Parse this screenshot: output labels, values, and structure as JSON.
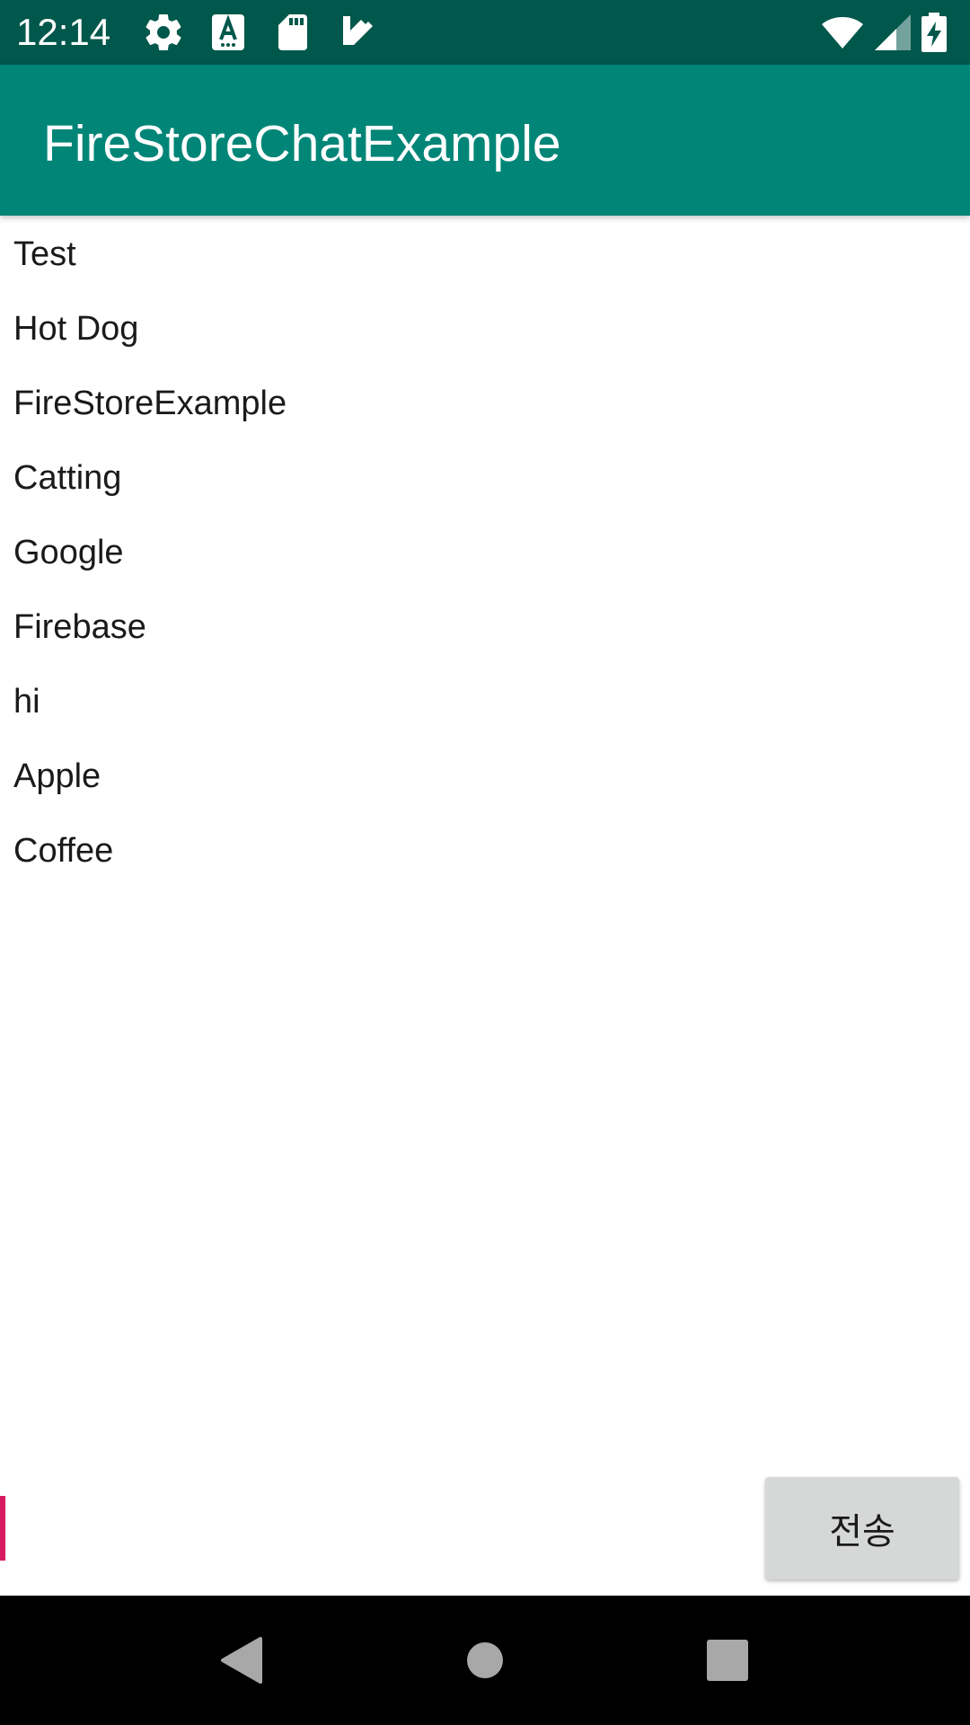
{
  "status_bar": {
    "time": "12:14",
    "icons": [
      "gear-icon",
      "keyboard-a-icon",
      "sd-card-icon",
      "task-check-icon",
      "wifi-icon",
      "signal-icon",
      "battery-charging-icon"
    ]
  },
  "app_bar": {
    "title": "FireStoreChatExample"
  },
  "messages": [
    {
      "text": "Test"
    },
    {
      "text": "Hot Dog"
    },
    {
      "text": "FireStoreExample"
    },
    {
      "text": "Catting"
    },
    {
      "text": "Google"
    },
    {
      "text": "Firebase"
    },
    {
      "text": "hi"
    },
    {
      "text": "Apple"
    },
    {
      "text": "Coffee"
    }
  ],
  "composer": {
    "input_value": "",
    "send_label": "전송"
  },
  "navigation": {
    "buttons": [
      "back-icon",
      "home-icon",
      "recents-icon"
    ]
  },
  "colors": {
    "status_bar": "#00574b",
    "app_bar": "#008577",
    "accent": "#d81b60",
    "button": "#d6d7d7",
    "nav_bar": "#000000"
  }
}
